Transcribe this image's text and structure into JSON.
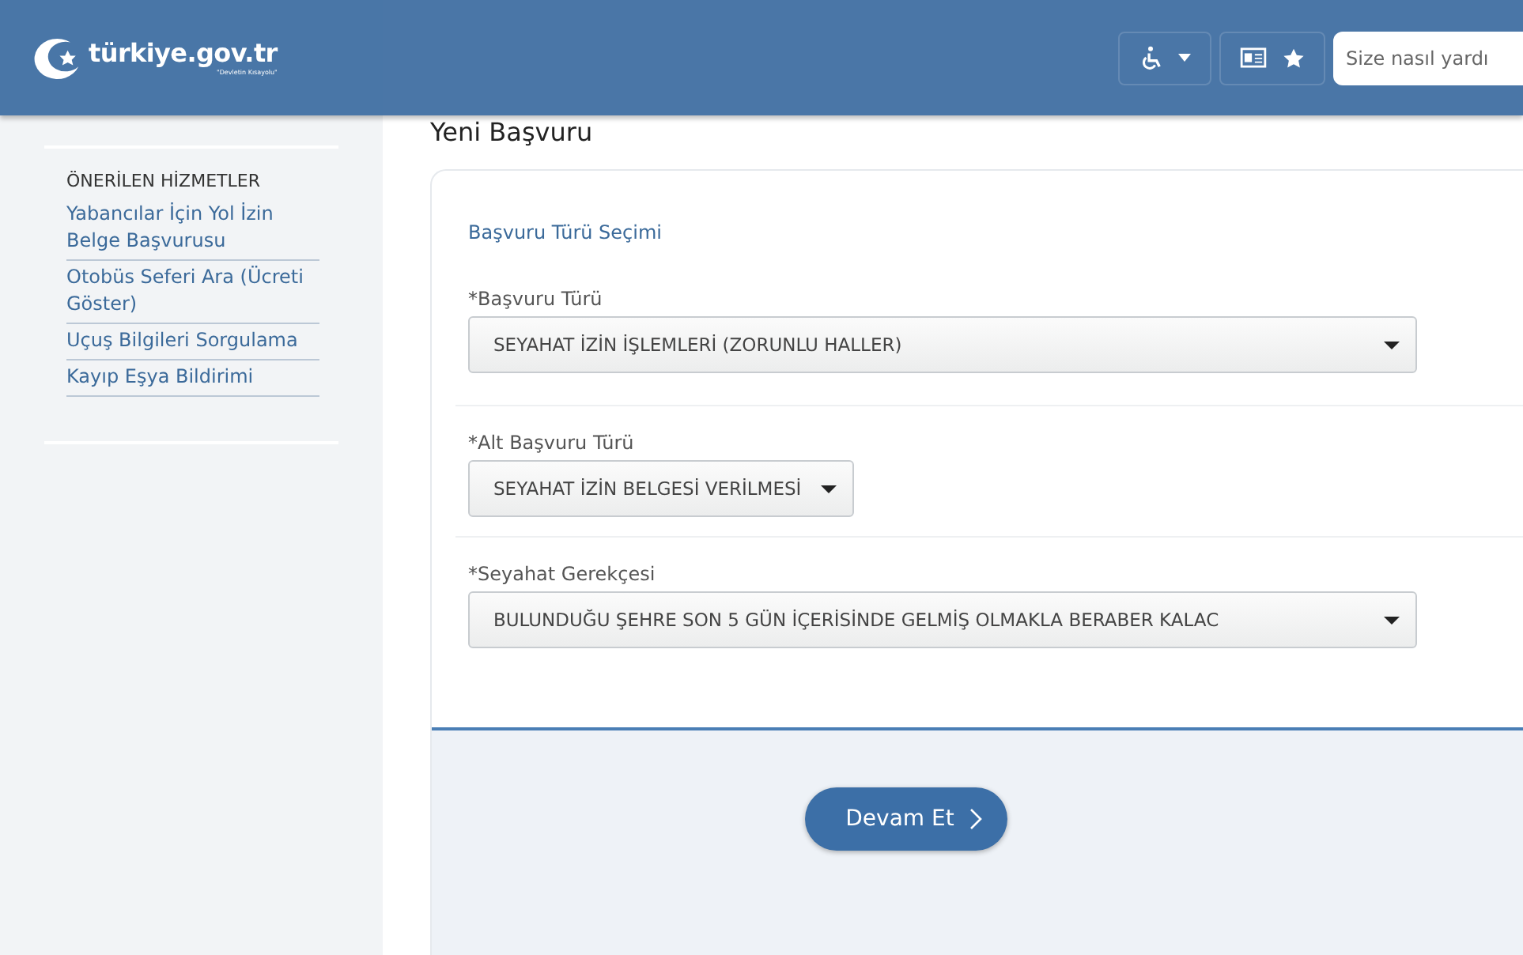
{
  "header": {
    "logo": "türkiye.gov.tr",
    "logo_tagline": "\"Devletin Kısayolu\"",
    "search": {
      "placeholder": "Size nasıl yardı"
    }
  },
  "sidebar": {
    "section_title": "ÖNERİLEN HİZMETLER",
    "items": [
      {
        "label": "Yabancılar İçin Yol İzin Belge Başvurusu"
      },
      {
        "label": "Otobüs Seferi Ara (Ücreti Göster)"
      },
      {
        "label": "Uçuş Bilgileri Sorgulama"
      },
      {
        "label": "Kayıp Eşya Bildirimi"
      }
    ]
  },
  "page_title": "Yeni Başvuru",
  "form": {
    "section_title": "Başvuru Türü Seçimi",
    "fields": [
      {
        "label": "*Başvuru Türü",
        "value": "SEYAHAT İZİN İŞLEMLERİ (ZORUNLU HALLER)",
        "wide": true
      },
      {
        "label": "*Alt Başvuru Türü",
        "value": "SEYAHAT İZİN BELGESİ VERİLMESİ",
        "wide": false
      },
      {
        "label": "*Seyahat Gerekçesi",
        "value": "BULUNDUĞU ŞEHRE SON 5 GÜN İÇERİSİNDE GELMİŞ OLMAKLA BERABER KALAC",
        "wide": true
      }
    ],
    "submit": "Devam Et"
  }
}
